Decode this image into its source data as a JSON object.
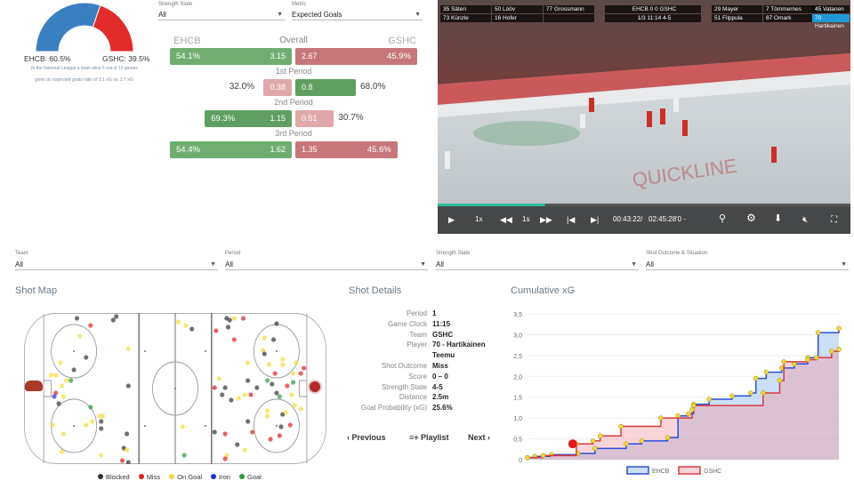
{
  "gauge": {
    "ehcb_pct": 60.5,
    "ehcb_label": "EHCB: 60.5%",
    "gshc_label": "GSHC: 39.5%",
    "note_line1": "In the National League a team wins 6 out of 10 games",
    "note_line2": "given an expected goals ratio of 3.1 xG vs. 2.7 xG.",
    "colors": {
      "ehcb": "#3a7fc0",
      "gshc": "#e32b2b"
    }
  },
  "filters_top": {
    "strength": {
      "label": "Strength State",
      "value": "All"
    },
    "metric": {
      "label": "Metric",
      "value": "Expected Goals"
    }
  },
  "comparison": {
    "home": "EHCB",
    "away": "GSHC",
    "rows": [
      {
        "label": "Overall",
        "home_pct": "54.1%",
        "home_xg": 3.15,
        "away_xg": 2.67,
        "away_pct": "45.9%"
      },
      {
        "label": "1st Period",
        "home_pct": "32.0%",
        "home_xg": 0.38,
        "away_xg": 0.8,
        "away_pct": "68.0%"
      },
      {
        "label": "2nd Period",
        "home_pct": "69.3%",
        "home_xg": 1.15,
        "away_xg": 0.51,
        "away_pct": "30.7%"
      },
      {
        "label": "3rd Period",
        "home_pct": "54.4%",
        "home_xg": 1.62,
        "away_xg": 1.35,
        "away_pct": "45.6%"
      }
    ]
  },
  "video": {
    "overlay_left": [
      [
        "35 Säteri",
        "50 Lööv",
        "77 Grossmann"
      ],
      [
        "73 Künzle",
        "16 Hofer",
        ""
      ]
    ],
    "score_line": "EHCB 0  0 GSHC",
    "clock_line": "1/3  11:14  4-5",
    "overlay_right": [
      [
        "29 Mayer",
        "7 Tömmernes",
        "45 Vatanen"
      ],
      [
        "51 Filppula",
        "67 Omark",
        "70 Hartikainen"
      ]
    ],
    "progress": 0.26,
    "speed": "1x",
    "step": "1s",
    "time": "00:43:22/",
    "duration": "02:45:28'0 -"
  },
  "filters": [
    {
      "label": "Team",
      "value": "All"
    },
    {
      "label": "Period",
      "value": "All"
    },
    {
      "label": "Strength State",
      "value": "All"
    },
    {
      "label": "Shot Outcome & Situation",
      "value": "All"
    }
  ],
  "shot_map": {
    "title": "Shot Map",
    "legend": [
      {
        "label": "Blocked",
        "color": "#333333"
      },
      {
        "label": "Miss",
        "color": "#e02020"
      },
      {
        "label": "On Goal",
        "color": "#f5dc3c"
      },
      {
        "label": "Iron",
        "color": "#1c2fd0"
      },
      {
        "label": "Goal",
        "color": "#2f9a3a"
      }
    ],
    "shots": [
      [
        35,
        3,
        "B"
      ],
      [
        44,
        7,
        "M"
      ],
      [
        59,
        4,
        "B"
      ],
      [
        61,
        2,
        "B"
      ],
      [
        37,
        13,
        "O"
      ],
      [
        69,
        20,
        "O"
      ],
      [
        41,
        25,
        "B"
      ],
      [
        33,
        32,
        "B"
      ],
      [
        24,
        28,
        "O"
      ],
      [
        18,
        35,
        "O"
      ],
      [
        21,
        35,
        "O"
      ],
      [
        28,
        38,
        "O"
      ],
      [
        31,
        38,
        "G"
      ],
      [
        25,
        41,
        "O"
      ],
      [
        21,
        45,
        "M"
      ],
      [
        20,
        47,
        "I"
      ],
      [
        26,
        47,
        "O"
      ],
      [
        23,
        51,
        "B"
      ],
      [
        69,
        41,
        "B"
      ],
      [
        44,
        53,
        "G"
      ],
      [
        50,
        58,
        "O"
      ],
      [
        52,
        58,
        "O"
      ],
      [
        51,
        61,
        "B"
      ],
      [
        51,
        65,
        "B"
      ],
      [
        19,
        63,
        "O"
      ],
      [
        26,
        68,
        "O"
      ],
      [
        41,
        63,
        "O"
      ],
      [
        45,
        61,
        "O"
      ],
      [
        68,
        68,
        "B"
      ],
      [
        66,
        76,
        "B"
      ],
      [
        68,
        77,
        "O"
      ],
      [
        51,
        80,
        "O"
      ],
      [
        25,
        78,
        "O"
      ],
      [
        65,
        83,
        "M"
      ],
      [
        69,
        84,
        "B"
      ],
      [
        102,
        5,
        "O"
      ],
      [
        107,
        7,
        "O"
      ],
      [
        111,
        9,
        "B"
      ],
      [
        105,
        64,
        "O"
      ],
      [
        106,
        80,
        "G"
      ],
      [
        134,
        3,
        "B"
      ],
      [
        136,
        4,
        "B"
      ],
      [
        139,
        3,
        "O"
      ],
      [
        145,
        3,
        "M"
      ],
      [
        135,
        8,
        "B"
      ],
      [
        127,
        10,
        "M"
      ],
      [
        139,
        15,
        "M"
      ],
      [
        167,
        6,
        "B"
      ],
      [
        159,
        14,
        "O"
      ],
      [
        165,
        15,
        "B"
      ],
      [
        158,
        21,
        "O"
      ],
      [
        159,
        23,
        "B"
      ],
      [
        148,
        28,
        "O"
      ],
      [
        162,
        29,
        "O"
      ],
      [
        171,
        26,
        "O"
      ],
      [
        171,
        29,
        "O"
      ],
      [
        180,
        28,
        "O"
      ],
      [
        185,
        31,
        "M"
      ],
      [
        166,
        34,
        "M"
      ],
      [
        178,
        34,
        "O"
      ],
      [
        183,
        34,
        "M"
      ],
      [
        129,
        37,
        "O"
      ],
      [
        148,
        38,
        "B"
      ],
      [
        161,
        38,
        "G"
      ],
      [
        164,
        40,
        "B"
      ],
      [
        178,
        39,
        "G"
      ],
      [
        174,
        41,
        "M"
      ],
      [
        126,
        42,
        "M"
      ],
      [
        133,
        42,
        "B"
      ],
      [
        154,
        42,
        "B"
      ],
      [
        131,
        46,
        "B"
      ],
      [
        137,
        49,
        "B"
      ],
      [
        142,
        48,
        "O"
      ],
      [
        146,
        46,
        "O"
      ],
      [
        150,
        46,
        "M"
      ],
      [
        167,
        45,
        "B"
      ],
      [
        169,
        47,
        "G"
      ],
      [
        177,
        46,
        "O"
      ],
      [
        179,
        52,
        "O"
      ],
      [
        183,
        54,
        "O"
      ],
      [
        161,
        55,
        "O"
      ],
      [
        161,
        58,
        "O"
      ],
      [
        171,
        57,
        "B"
      ],
      [
        173,
        56,
        "O"
      ],
      [
        148,
        61,
        "B"
      ],
      [
        151,
        67,
        "M"
      ],
      [
        170,
        64,
        "B"
      ],
      [
        176,
        63,
        "M"
      ],
      [
        169,
        69,
        "M"
      ],
      [
        163,
        71,
        "M"
      ],
      [
        126,
        67,
        "B"
      ],
      [
        133,
        68,
        "M"
      ],
      [
        141,
        74,
        "B"
      ],
      [
        146,
        77,
        "O"
      ],
      [
        134,
        80,
        "O"
      ],
      [
        133,
        82,
        "M"
      ]
    ]
  },
  "shot_details": {
    "title": "Shot Details",
    "rows": [
      {
        "k": "Period",
        "v": "1"
      },
      {
        "k": "Game Clock",
        "v": "11:15"
      },
      {
        "k": "Team",
        "v": "GSHC"
      },
      {
        "k": "Player",
        "v": "70 - Hartikainen"
      },
      {
        "k": "",
        "v": "Teemu"
      },
      {
        "k": "Shot Outcome",
        "v": "Miss"
      },
      {
        "k": "Score",
        "v": "0 – 0"
      },
      {
        "k": "Strength State",
        "v": "4-5"
      },
      {
        "k": "Distance",
        "v": "2.5m"
      },
      {
        "k": "Goal Probability (xG)",
        "v": "25.6%"
      }
    ],
    "previous": "Previous",
    "playlist": "Playlist",
    "next": "Next"
  },
  "chart_data": {
    "type": "line",
    "title": "Cumulative xG",
    "ylim": [
      0,
      3.5
    ],
    "yticks": [
      "0",
      "0,5",
      "1,0",
      "1,5",
      "2,0",
      "2,5",
      "3,0",
      "3,5"
    ],
    "grid": true,
    "legend_placement": "bottom",
    "series": [
      {
        "name": "EHCB",
        "color": "#2b4fd8",
        "steps": [
          [
            0,
            0.05
          ],
          [
            1.4,
            0.08
          ],
          [
            4.6,
            0.12
          ],
          [
            9.7,
            0.15
          ],
          [
            13,
            0.27
          ],
          [
            19,
            0.38
          ],
          [
            22,
            0.45
          ],
          [
            27,
            0.53
          ],
          [
            29,
            1.05
          ],
          [
            31,
            1.1
          ],
          [
            32,
            1.33
          ],
          [
            35,
            1.45
          ],
          [
            39.4,
            1.53
          ],
          [
            43,
            1.6
          ],
          [
            44,
            1.95
          ],
          [
            46,
            2.1
          ],
          [
            49,
            2.2
          ],
          [
            51.4,
            2.3
          ],
          [
            54,
            2.45
          ],
          [
            56,
            3.05
          ],
          [
            60,
            3.15
          ]
        ]
      },
      {
        "name": "GSHC",
        "color": "#d93a3a",
        "steps": [
          [
            0,
            0.05
          ],
          [
            3,
            0.1
          ],
          [
            9.4,
            0.38
          ],
          [
            12.6,
            0.45
          ],
          [
            14,
            0.57
          ],
          [
            18,
            0.8
          ],
          [
            25.7,
            1.0
          ],
          [
            31.7,
            1.2
          ],
          [
            32,
            1.3
          ],
          [
            45.4,
            1.6
          ],
          [
            48.6,
            1.9
          ],
          [
            49.4,
            2.35
          ],
          [
            54,
            2.4
          ],
          [
            55.7,
            2.45
          ],
          [
            58.6,
            2.6
          ],
          [
            60,
            2.65
          ]
        ]
      }
    ]
  }
}
